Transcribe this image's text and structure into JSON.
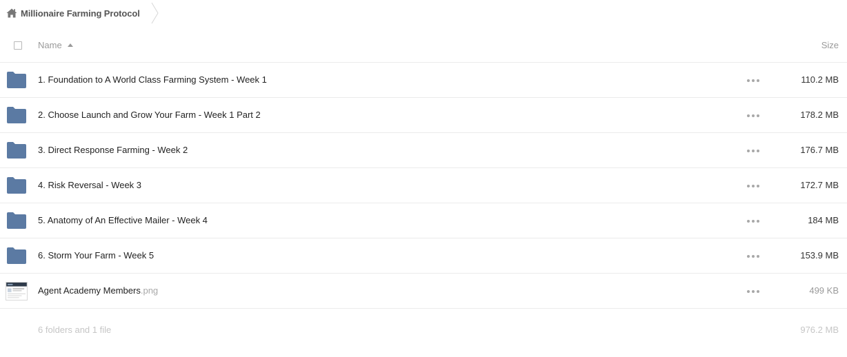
{
  "breadcrumb": {
    "home_icon": "home-icon",
    "current": "Millionaire Farming Protocol"
  },
  "header": {
    "name_label": "Name",
    "sort_direction": "ascending",
    "size_label": "Size"
  },
  "colors": {
    "folder": "#5b7aa3",
    "row_border": "#ebebeb",
    "muted_text": "#9a9a9a"
  },
  "rows": [
    {
      "type": "folder",
      "icon": "folder-icon",
      "name": "1. Foundation to A World Class Farming System - Week 1",
      "ext": "",
      "size": "110.2 MB"
    },
    {
      "type": "folder",
      "icon": "folder-icon",
      "name": "2. Choose Launch and Grow Your Farm - Week 1 Part 2",
      "ext": "",
      "size": "178.2 MB"
    },
    {
      "type": "folder",
      "icon": "folder-icon",
      "name": "3. Direct Response Farming - Week 2",
      "ext": "",
      "size": "176.7 MB"
    },
    {
      "type": "folder",
      "icon": "folder-icon",
      "name": "4. Risk Reversal - Week 3",
      "ext": "",
      "size": "172.7 MB"
    },
    {
      "type": "folder",
      "icon": "folder-icon",
      "name": "5. Anatomy of An Effective Mailer - Week 4",
      "ext": "",
      "size": "184 MB"
    },
    {
      "type": "folder",
      "icon": "folder-icon",
      "name": "6. Storm Your Farm - Week 5",
      "ext": "",
      "size": "153.9 MB"
    },
    {
      "type": "file",
      "icon": "image-thumbnail-icon",
      "name": "Agent Academy Members",
      "ext": ".png",
      "size": "499 KB"
    }
  ],
  "footer": {
    "summary": "6 folders and 1 file",
    "total": "976.2 MB"
  }
}
